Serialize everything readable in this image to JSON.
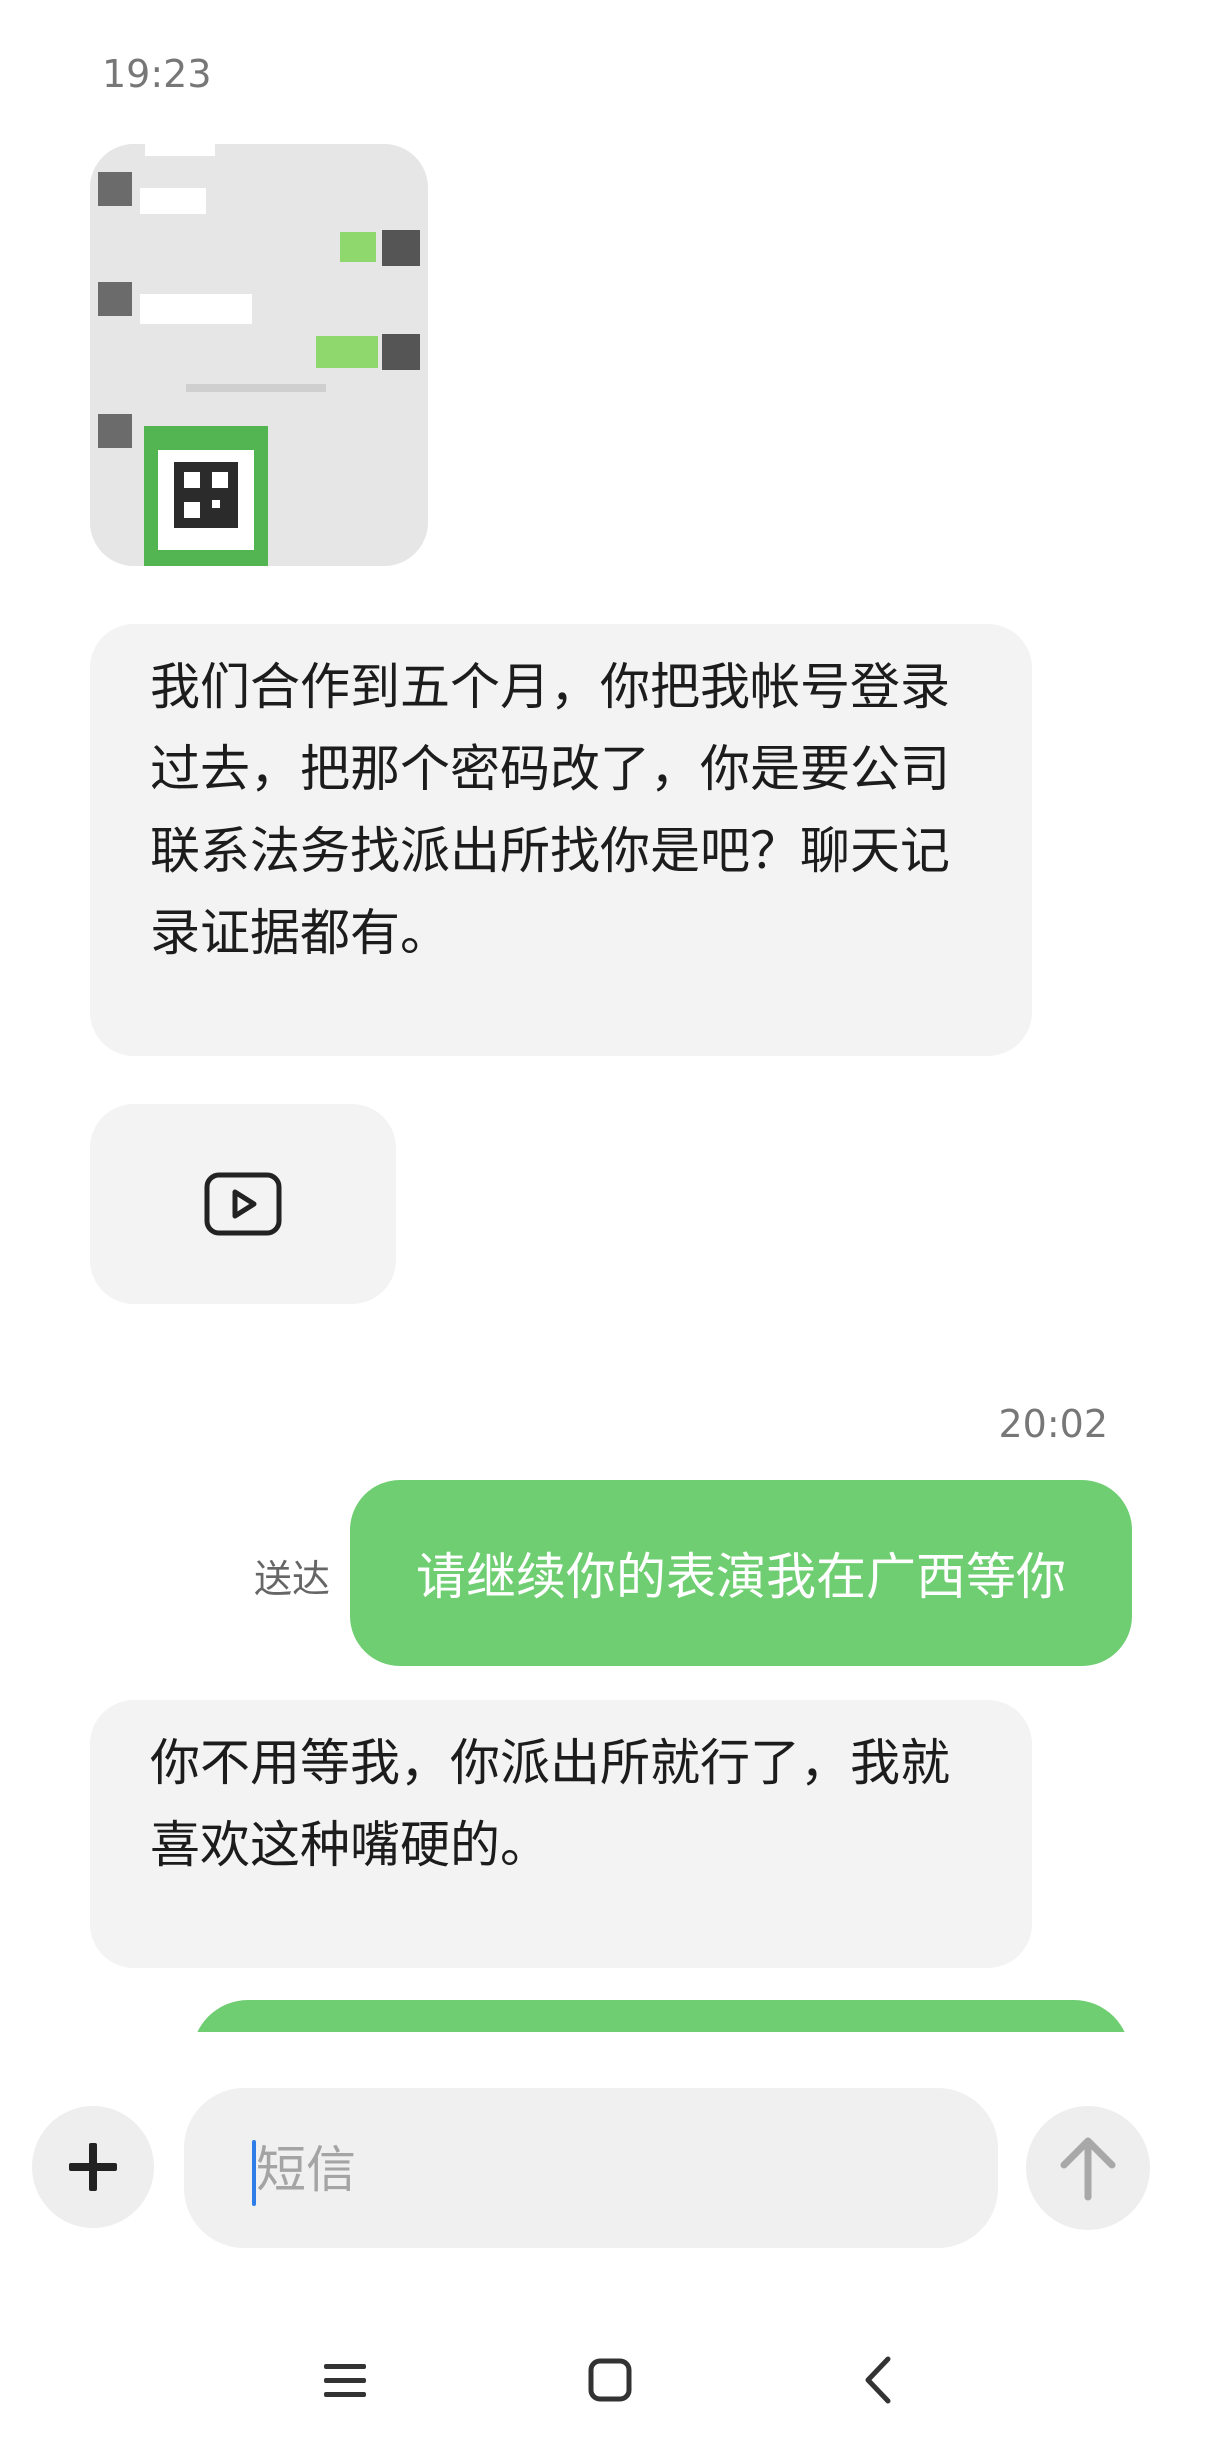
{
  "messages": {
    "timestamp_1": "19:23",
    "image_message": {
      "icon": "chat-screenshot-image"
    },
    "incoming_1": "我们合作到五个月，你把我帐号登录过去，把那个密码改了，你是要公司联系法务找派出所找你是吧？聊天记录证据都有。",
    "video_message": {
      "icon": "play-video-icon"
    },
    "timestamp_2": "20:02",
    "outgoing_1": "请继续你的表演我在广西等你",
    "outgoing_1_status": "送达",
    "incoming_2": "你不用等我，你派出所就行了，我就喜欢这种嘴硬的。"
  },
  "composer": {
    "placeholder": "短信",
    "add_icon": "plus-icon",
    "send_icon": "arrow-up-icon"
  },
  "navbar": {
    "menu_icon": "menu-icon",
    "home_icon": "home-icon",
    "back_icon": "back-icon"
  },
  "colors": {
    "outgoing_bubble": "#6fce72",
    "incoming_bubble": "#f3f3f3",
    "caret": "#2f7de8"
  }
}
